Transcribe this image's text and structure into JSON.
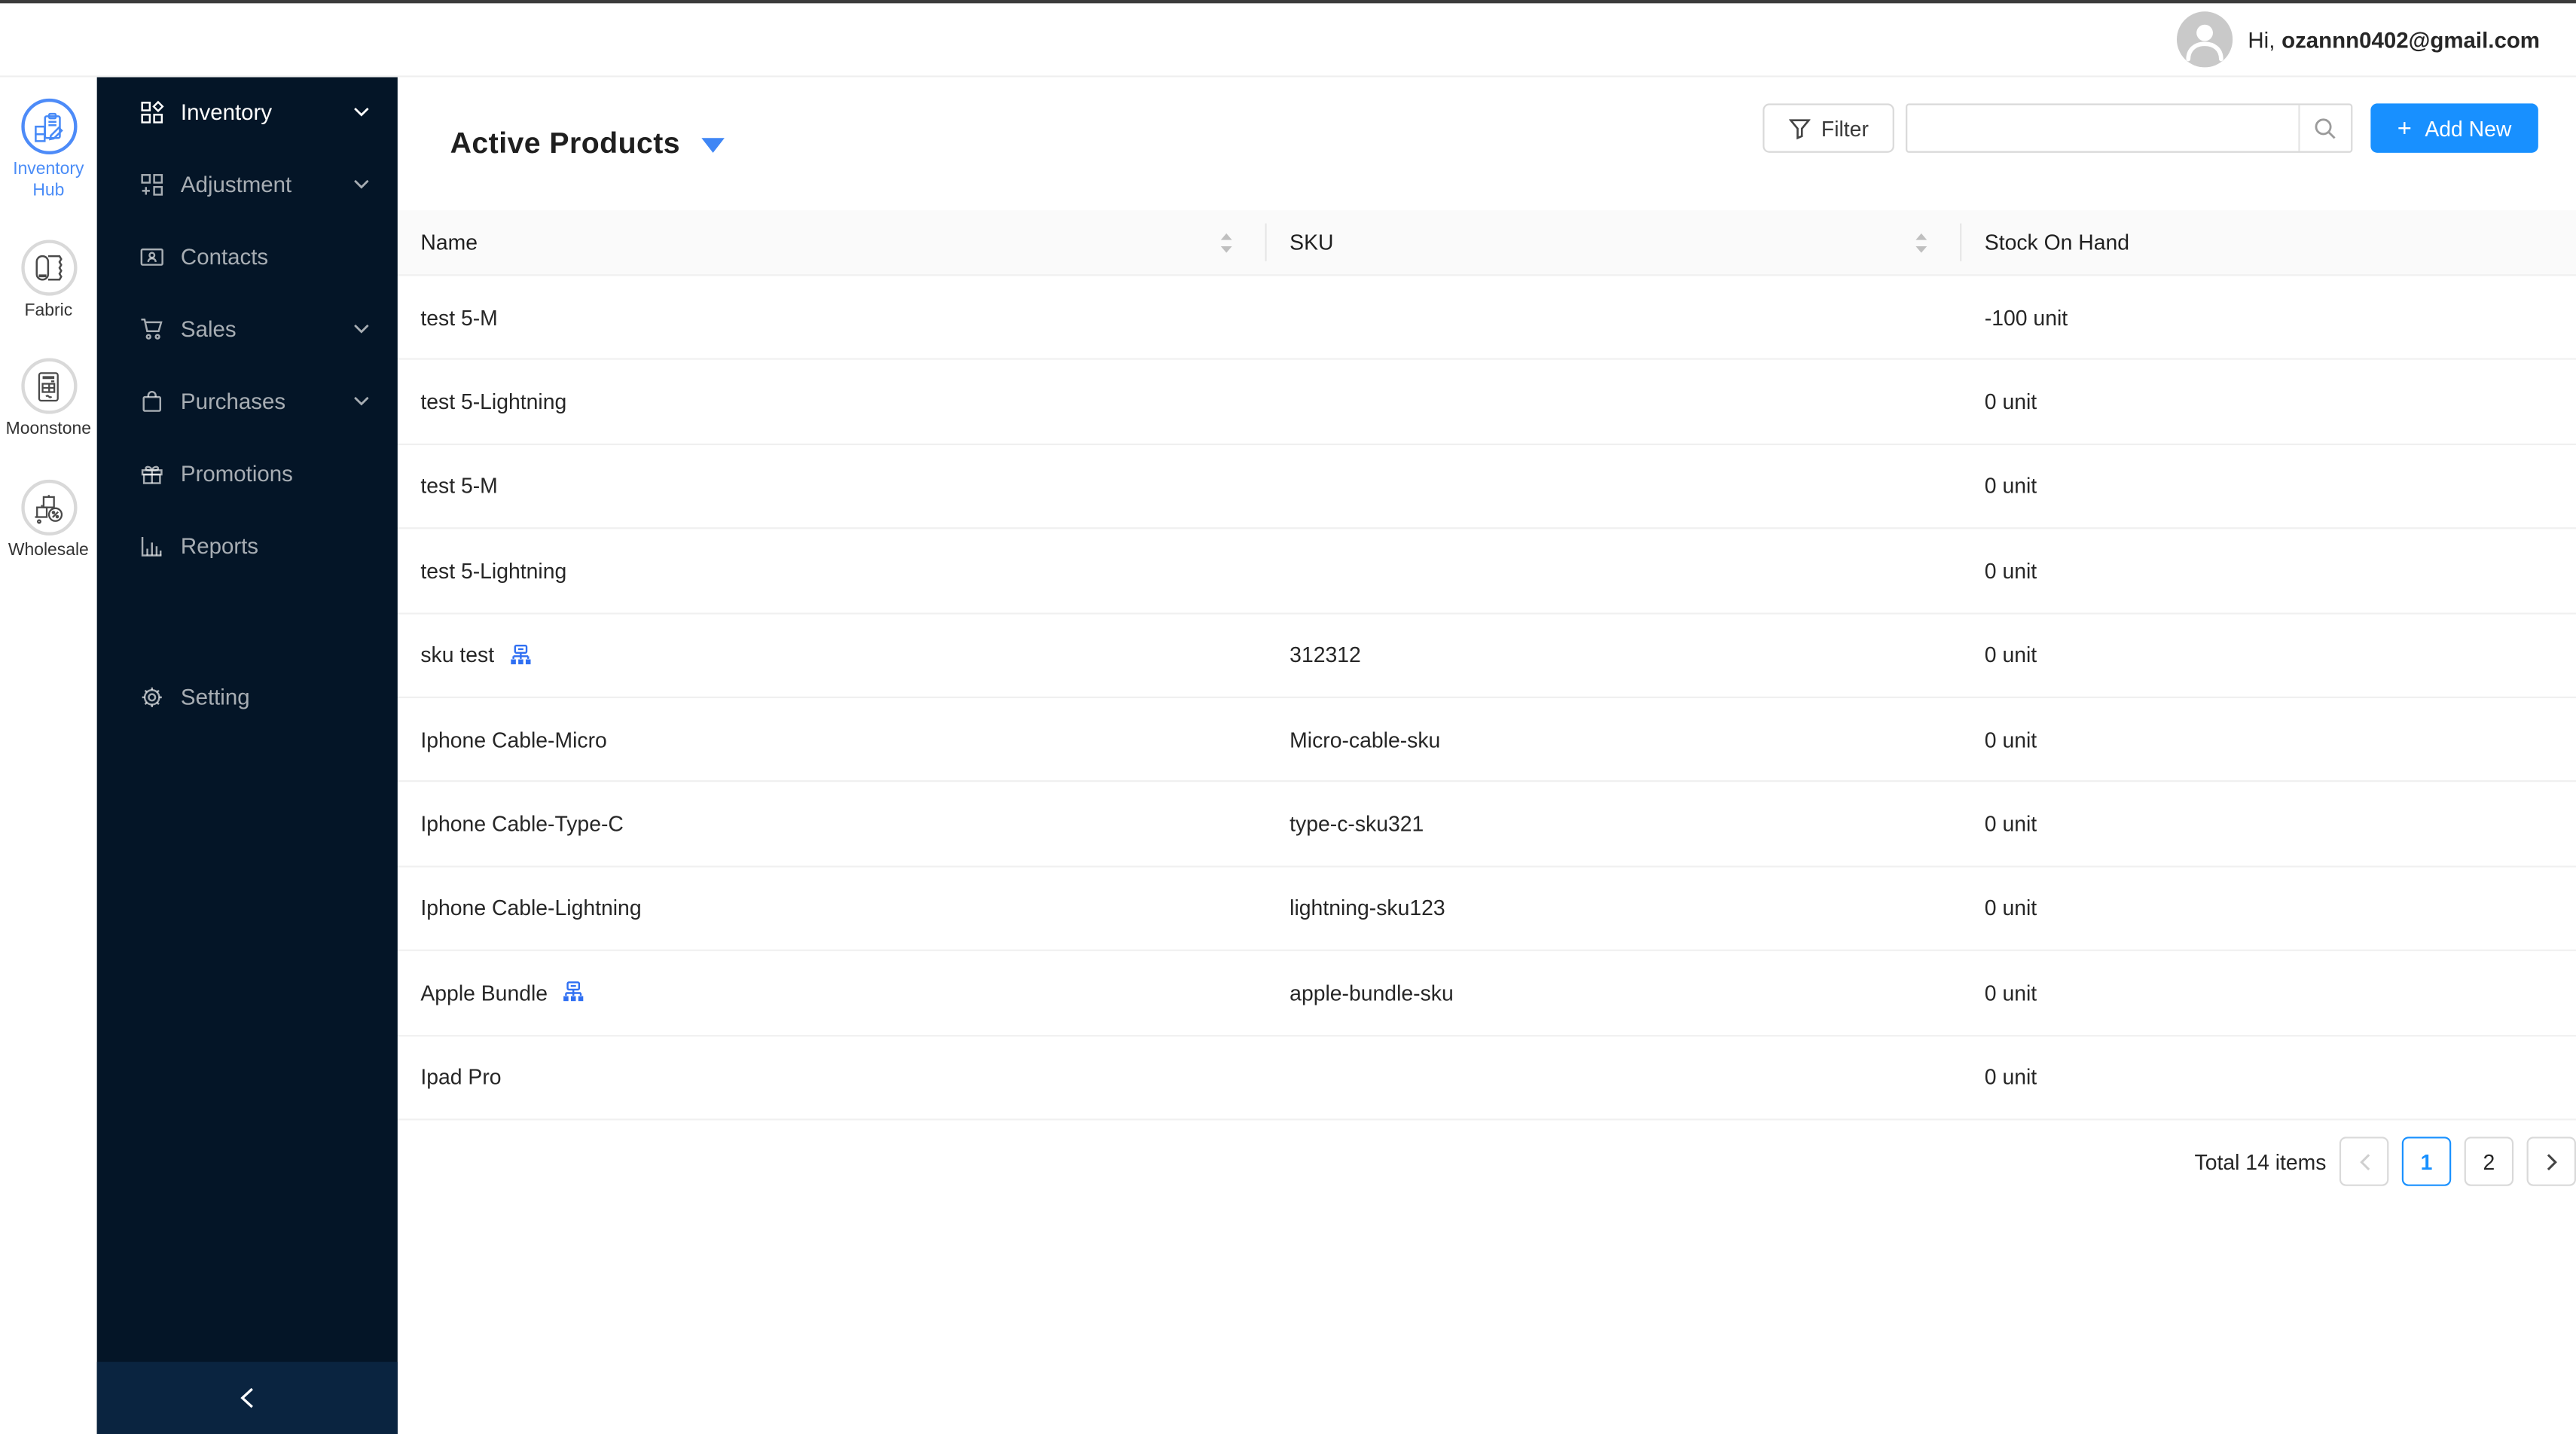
{
  "theme": {
    "primary_blue": "#1890ff",
    "accent_blue": "#3f86f5",
    "sidebar_bg": "#041527",
    "sidebar_trigger_bg": "#0a2440",
    "top_strip": "#3b3b3b",
    "header_bg": "#fafafa"
  },
  "topbar": {
    "greeting_prefix": "Hi,",
    "user_email": "ozannn0402@gmail.com",
    "avatar_icon": "user-icon"
  },
  "app_rail": {
    "apps": [
      {
        "label": "Inventory Hub",
        "icon": "inventory-hub-icon",
        "active": true
      },
      {
        "label": "Fabric",
        "icon": "fabric-roll-icon",
        "active": false
      },
      {
        "label": "Moonstone",
        "icon": "invoice-icon",
        "active": false
      },
      {
        "label": "Wholesale",
        "icon": "wholesale-boxes-icon",
        "active": false
      }
    ]
  },
  "sidebar": {
    "items": [
      {
        "label": "Inventory",
        "icon": "appstore-icon",
        "expandable": true,
        "active": true
      },
      {
        "label": "Adjustment",
        "icon": "adjustment-grid-icon",
        "expandable": true,
        "active": false
      },
      {
        "label": "Contacts",
        "icon": "contact-card-icon",
        "expandable": false,
        "active": false
      },
      {
        "label": "Sales",
        "icon": "cart-icon",
        "expandable": true,
        "active": false
      },
      {
        "label": "Purchases",
        "icon": "bag-icon",
        "expandable": true,
        "active": false
      },
      {
        "label": "Promotions",
        "icon": "gift-icon",
        "expandable": false,
        "active": false
      },
      {
        "label": "Reports",
        "icon": "bar-chart-icon",
        "expandable": false,
        "active": false
      },
      {
        "label": "Setting",
        "icon": "gear-icon",
        "expandable": false,
        "active": false
      }
    ],
    "collapse_icon": "chevron-left-icon"
  },
  "page": {
    "title": "Active Products",
    "title_caret_icon": "caret-down-icon"
  },
  "toolbar": {
    "filter_label": "Filter",
    "filter_icon": "funnel-icon",
    "search_placeholder": "",
    "search_value": "",
    "search_icon": "search-icon",
    "add_new_plus": "+",
    "add_new_label": "Add New"
  },
  "table": {
    "columns": [
      {
        "label": "Name",
        "sortable": true
      },
      {
        "label": "SKU",
        "sortable": true
      },
      {
        "label": "Stock On Hand",
        "sortable": false
      }
    ],
    "rows": [
      {
        "name": "test 5-M",
        "sku": "",
        "stock": "-100 unit"
      },
      {
        "name": "test 5-Lightning",
        "sku": "",
        "stock": "0 unit"
      },
      {
        "name": "test 5-M",
        "sku": "",
        "stock": "0 unit"
      },
      {
        "name": "test 5-Lightning",
        "sku": "",
        "stock": "0 unit"
      },
      {
        "name": "sku test",
        "bundle_icon": "cluster-icon",
        "sku": "312312",
        "stock": "0 unit"
      },
      {
        "name": "Iphone Cable-Micro",
        "sku": "Micro-cable-sku",
        "stock": "0 unit"
      },
      {
        "name": "Iphone Cable-Type-C",
        "sku": "type-c-sku321",
        "stock": "0 unit"
      },
      {
        "name": "Iphone Cable-Lightning",
        "sku": "lightning-sku123",
        "stock": "0 unit"
      },
      {
        "name": "Apple Bundle",
        "bundle_icon": "cluster-icon",
        "sku": "apple-bundle-sku",
        "stock": "0 unit"
      },
      {
        "name": "Ipad Pro",
        "sku": "",
        "stock": "0 unit"
      }
    ]
  },
  "pagination": {
    "total_text": "Total 14 items",
    "pages": [
      "1",
      "2"
    ],
    "current_page": "1",
    "prev_icon": "chevron-left-icon",
    "next_icon": "chevron-right-icon",
    "prev_disabled": true
  }
}
